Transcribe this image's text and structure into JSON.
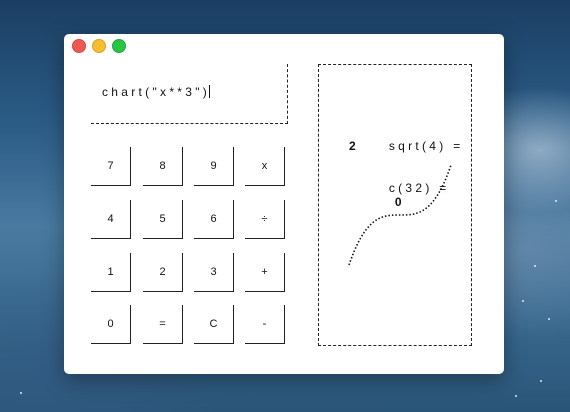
{
  "window": {
    "traffic_lights": {
      "close": "#ee5a52",
      "minimize": "#f5be33",
      "maximize": "#2ac545"
    }
  },
  "display": {
    "text": "chart(\"x**3\")"
  },
  "keypad": {
    "rows": [
      [
        "7",
        "8",
        "9",
        "x"
      ],
      [
        "4",
        "5",
        "6",
        "÷"
      ],
      [
        "1",
        "2",
        "3",
        "+"
      ],
      [
        "0",
        "=",
        "C",
        "-"
      ]
    ]
  },
  "output": {
    "line1": {
      "expr": "sqrt(4) =",
      "result": "2"
    },
    "line2": {
      "expr": "c(32) =",
      "result": "0"
    }
  },
  "chart_data": {
    "type": "line",
    "function": "x**3",
    "style": "dotted",
    "x": [
      -1.0,
      -0.8,
      -0.6,
      -0.4,
      -0.2,
      0.0,
      0.2,
      0.4,
      0.6,
      0.8,
      1.0
    ],
    "y": [
      -1.0,
      -0.512,
      -0.216,
      -0.064,
      -0.008,
      0.0,
      0.008,
      0.064,
      0.216,
      0.512,
      1.0
    ],
    "xlim": [
      -1,
      1
    ],
    "ylim": [
      -1,
      1
    ],
    "grid": false
  }
}
